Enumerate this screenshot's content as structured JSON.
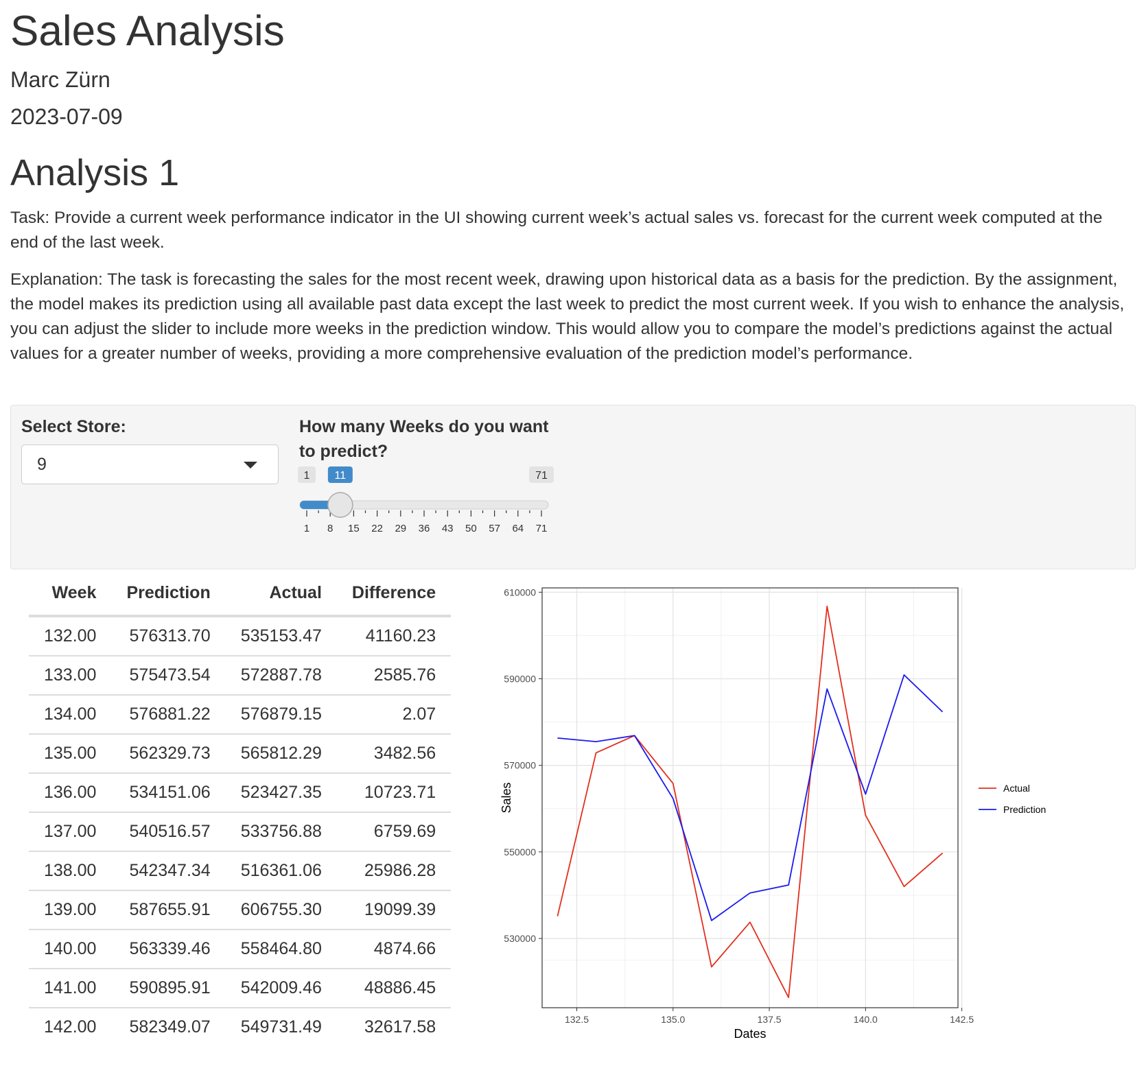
{
  "header": {
    "title": "Sales Analysis",
    "author": "Marc Zürn",
    "date": "2023-07-09"
  },
  "section": {
    "heading": "Analysis 1",
    "task": "Task: Provide a current week performance indicator in the UI showing current week’s actual sales vs. forecast for the current week computed at the end of the last week.",
    "explanation": "Explanation: The task is forecasting the sales for the most recent week, drawing upon historical data as a basis for the prediction. By the assignment, the model makes its prediction using all available past data except the last week to predict the most current week. If you wish to enhance the analysis, you can adjust the slider to include more weeks in the prediction window. This would allow you to compare the model’s predictions against the actual values for a greater number of weeks, providing a more comprehensive evaluation of the prediction model’s performance."
  },
  "controls": {
    "store_label": "Select Store:",
    "store_value": "9",
    "slider_label": "How many Weeks do you want to predict?",
    "slider_min": 1,
    "slider_max": 71,
    "slider_value": 11,
    "slider_ticks": [
      "1",
      "8",
      "15",
      "22",
      "29",
      "36",
      "43",
      "50",
      "57",
      "64",
      "71"
    ],
    "slider_min_label": "1",
    "slider_max_label": "71",
    "slider_value_label": "11",
    "colors": {
      "slider_fill": "#428bca",
      "slider_badge": "#428bca"
    }
  },
  "table": {
    "columns": [
      "Week",
      "Prediction",
      "Actual",
      "Difference"
    ],
    "rows": [
      [
        "132.00",
        "576313.70",
        "535153.47",
        "41160.23"
      ],
      [
        "133.00",
        "575473.54",
        "572887.78",
        "2585.76"
      ],
      [
        "134.00",
        "576881.22",
        "576879.15",
        "2.07"
      ],
      [
        "135.00",
        "562329.73",
        "565812.29",
        "3482.56"
      ],
      [
        "136.00",
        "534151.06",
        "523427.35",
        "10723.71"
      ],
      [
        "137.00",
        "540516.57",
        "533756.88",
        "6759.69"
      ],
      [
        "138.00",
        "542347.34",
        "516361.06",
        "25986.28"
      ],
      [
        "139.00",
        "587655.91",
        "606755.30",
        "19099.39"
      ],
      [
        "140.00",
        "563339.46",
        "558464.80",
        "4874.66"
      ],
      [
        "141.00",
        "590895.91",
        "542009.46",
        "48886.45"
      ],
      [
        "142.00",
        "582349.07",
        "549731.49",
        "32617.58"
      ]
    ]
  },
  "chart_data": {
    "type": "line",
    "xlabel": "Dates",
    "ylabel": "Sales",
    "xlim": [
      131.6,
      142.4
    ],
    "ylim": [
      514000,
      611000
    ],
    "xticks": [
      "132.5",
      "135.0",
      "137.5",
      "140.0",
      "142.5"
    ],
    "xtick_values": [
      132.5,
      135.0,
      137.5,
      140.0,
      142.5
    ],
    "yticks": [
      "530000",
      "550000",
      "570000",
      "590000",
      "610000"
    ],
    "ytick_values": [
      530000,
      550000,
      570000,
      590000,
      610000
    ],
    "grid": true,
    "legend_position": "right",
    "x": [
      132,
      133,
      134,
      135,
      136,
      137,
      138,
      139,
      140,
      141,
      142
    ],
    "series": [
      {
        "name": "Actual",
        "color": "#e0301e",
        "values": [
          535153.47,
          572887.78,
          576879.15,
          565812.29,
          523427.35,
          533756.88,
          516361.06,
          606755.3,
          558464.8,
          542009.46,
          549731.49
        ]
      },
      {
        "name": "Prediction",
        "color": "#1a1aee",
        "values": [
          576313.7,
          575473.54,
          576881.22,
          562329.73,
          534151.06,
          540516.57,
          542347.34,
          587655.91,
          563339.46,
          590895.91,
          582349.07
        ]
      }
    ]
  }
}
